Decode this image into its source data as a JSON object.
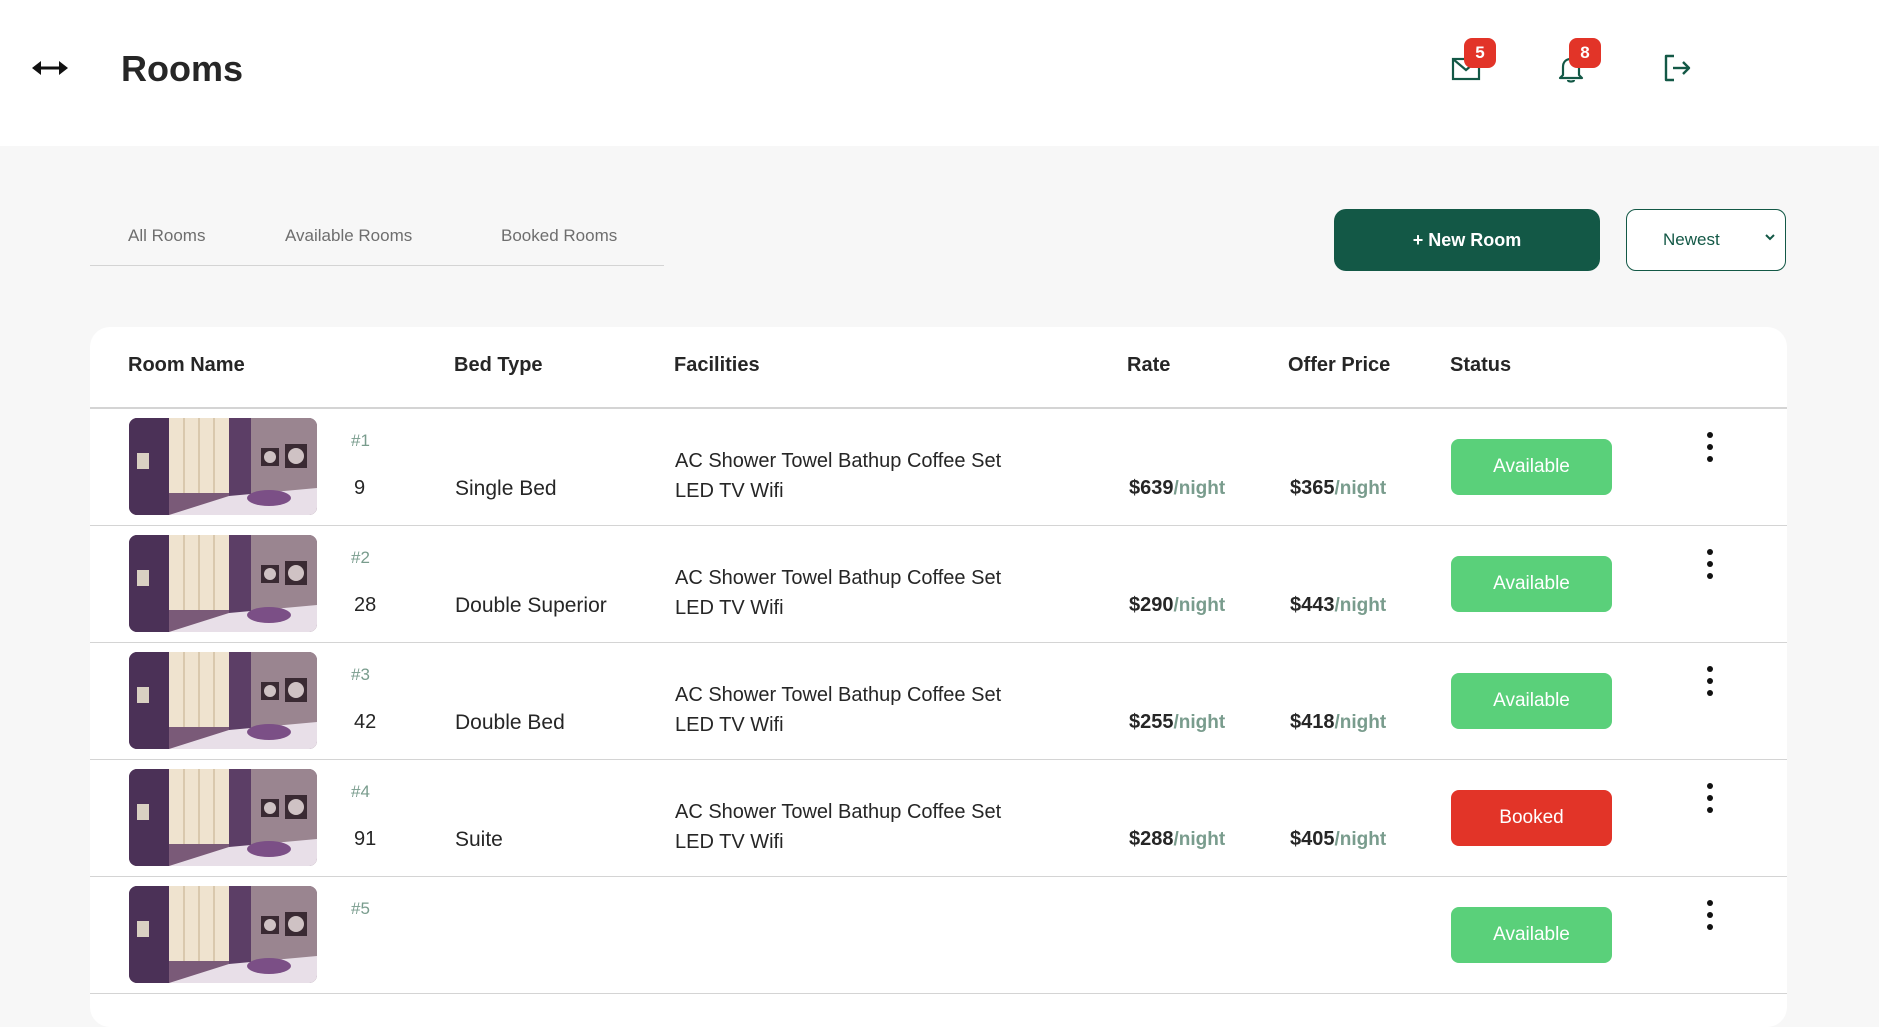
{
  "header": {
    "title": "Rooms"
  },
  "icons": {
    "toggle": "horizontal-arrows-icon",
    "mail": "mail-icon",
    "bell": "bell-icon",
    "logout": "logout-icon",
    "row_menu": "vertical-dots-icon"
  },
  "notifications": {
    "mail_count": "5",
    "bell_count": "8"
  },
  "tabs": [
    {
      "label": "All Rooms"
    },
    {
      "label": "Available Rooms"
    },
    {
      "label": "Booked Rooms"
    }
  ],
  "actions": {
    "new_room_label": "+ New Room",
    "sort_selected": "Newest"
  },
  "table": {
    "columns": [
      "Room Name",
      "Bed Type",
      "Facilities",
      "Rate",
      "Offer Price",
      "Status"
    ],
    "per_night": "/night",
    "rows": [
      {
        "id": "#1",
        "room_no": "9",
        "bed": "Single Bed",
        "facilities_line1": "AC Shower Towel Bathup Coffee Set",
        "facilities_line2": "LED TV Wifi",
        "rate": "$639",
        "offer": "$365",
        "status": "Available"
      },
      {
        "id": "#2",
        "room_no": "28",
        "bed": "Double Superior",
        "facilities_line1": "AC Shower Towel Bathup Coffee Set",
        "facilities_line2": "LED TV Wifi",
        "rate": "$290",
        "offer": "$443",
        "status": "Available"
      },
      {
        "id": "#3",
        "room_no": "42",
        "bed": "Double Bed",
        "facilities_line1": "AC Shower Towel Bathup Coffee Set",
        "facilities_line2": "LED TV Wifi",
        "rate": "$255",
        "offer": "$418",
        "status": "Available"
      },
      {
        "id": "#4",
        "room_no": "91",
        "bed": "Suite",
        "facilities_line1": "AC Shower Towel Bathup Coffee Set",
        "facilities_line2": "LED TV Wifi",
        "rate": "$288",
        "offer": "$405",
        "status": "Booked"
      },
      {
        "id": "#5",
        "room_no": "",
        "bed": "",
        "facilities_line1": "",
        "facilities_line2": "",
        "rate": "",
        "offer": "",
        "status": "Available"
      }
    ]
  },
  "colors": {
    "brand_green": "#135846",
    "available_green": "#5ad07a",
    "booked_red": "#e23428",
    "muted_green": "#799c8d",
    "page_bg": "#f7f7f7"
  }
}
